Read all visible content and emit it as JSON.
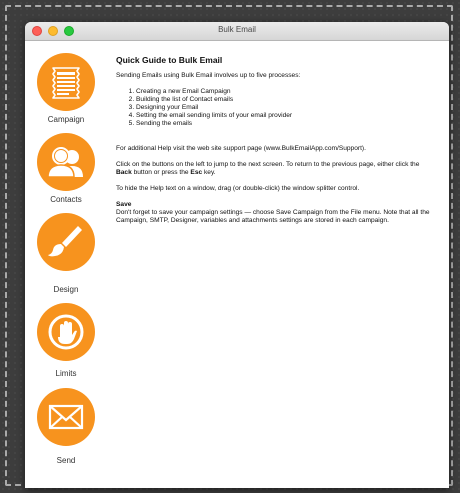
{
  "window": {
    "title": "Bulk Email"
  },
  "sidebar": {
    "items": [
      {
        "label": "Campaign",
        "icon": "campaign-icon"
      },
      {
        "label": "Contacts",
        "icon": "contacts-icon"
      },
      {
        "label": "Design",
        "icon": "brush-icon"
      },
      {
        "label": "Limits",
        "icon": "hand-icon"
      },
      {
        "label": "Send",
        "icon": "envelope-icon"
      }
    ]
  },
  "guide": {
    "heading": "Quick Guide to Bulk Email",
    "intro": "Sending Emails using Bulk Email involves up to five processes:",
    "steps": [
      "Creating a new Email Campaign",
      "Building the list of Contact emails",
      "Designing your Email",
      "Setting the email sending limits of your email provider",
      "Sending the emails"
    ],
    "support": "For additional Help visit the web site support page (www.BulkEmailApp.com/Support).",
    "nav_help_prefix": "Click on the buttons on the left to jump to the next screen. To return to the previous page, either click the ",
    "nav_help_back": "Back",
    "nav_help_middle": " button or press the ",
    "nav_help_esc": "Esc",
    "nav_help_suffix": " key.",
    "hide_help": "To hide the Help text on a window, drag (or double-click) the window splitter control.",
    "save_heading": "Save",
    "save_text": "Don't forget to save your campaign settings — choose Save Campaign from the File menu. Note that all the Campaign, SMTP, Designer, variables and attachments settings are stored in each campaign."
  },
  "colors": {
    "accent": "#f7931e"
  }
}
